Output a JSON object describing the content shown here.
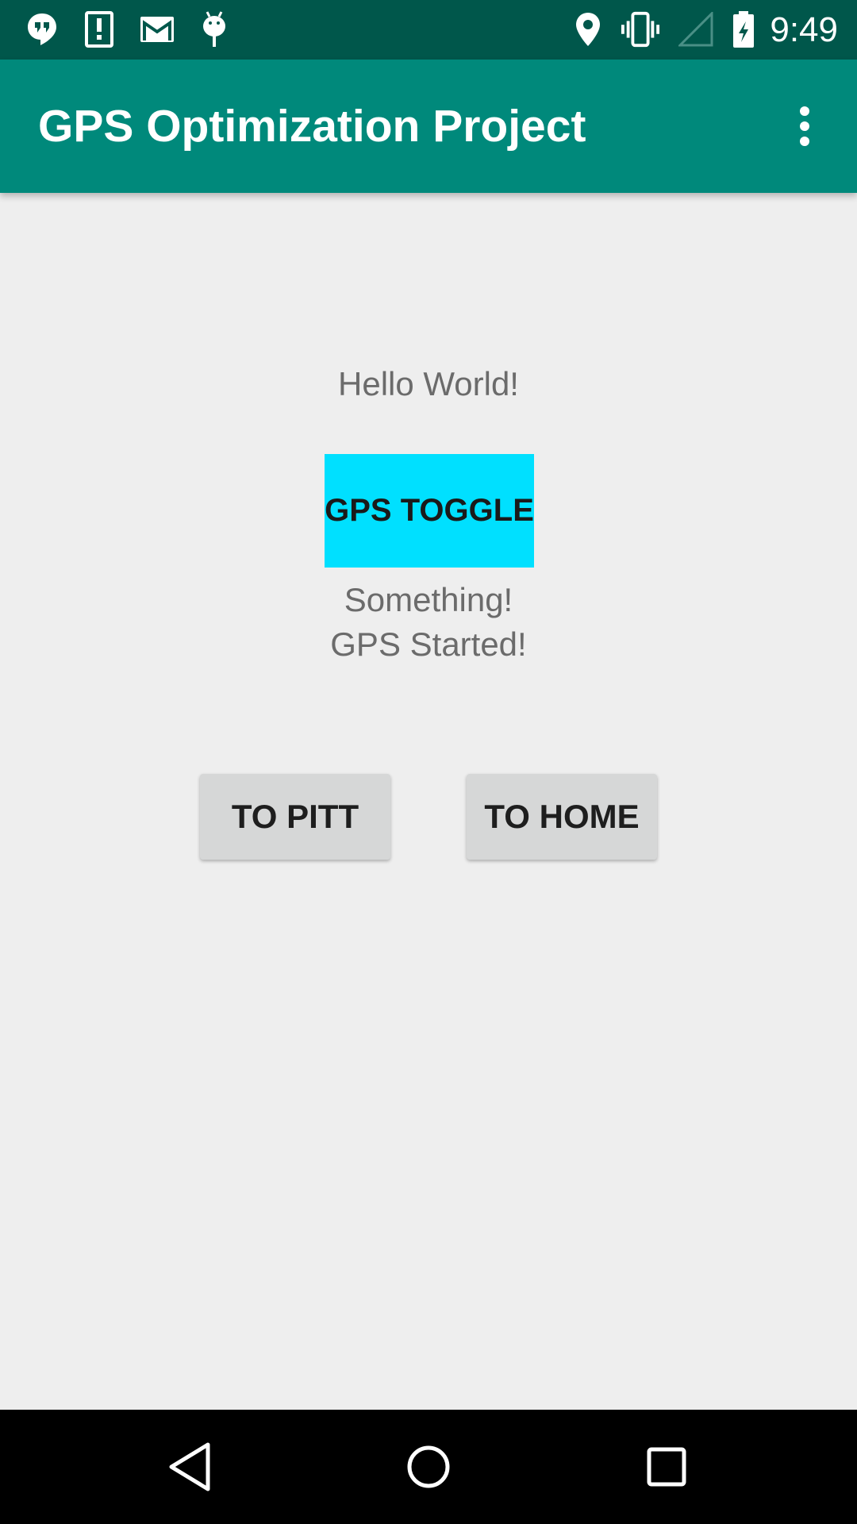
{
  "status_bar": {
    "time": "9:49",
    "left_icons": [
      "hangouts-icon",
      "alert-icon",
      "gmail-icon",
      "android-debug-icon"
    ],
    "right_icons": [
      "location-icon",
      "vibrate-icon",
      "signal-icon",
      "battery-icon"
    ]
  },
  "app_bar": {
    "title": "GPS Optimization Project",
    "menu_icon": "more-vertical-icon"
  },
  "main": {
    "hello_text": "Hello World!",
    "gps_toggle_label": "GPS TOGGLE",
    "status_lines": [
      "Something!",
      "GPS Started!"
    ],
    "to_pitt_label": "TO PITT",
    "to_home_label": "TO HOME"
  },
  "navigation_bar": {
    "icons": [
      "back-icon",
      "home-icon",
      "recents-icon"
    ]
  },
  "colors": {
    "status_bar": "#00574b",
    "app_bar": "#00897b",
    "gps_toggle": "#00e0ff",
    "button_grey": "#d6d7d7",
    "background": "#eeeeee",
    "text_grey": "#6b6b6b"
  }
}
